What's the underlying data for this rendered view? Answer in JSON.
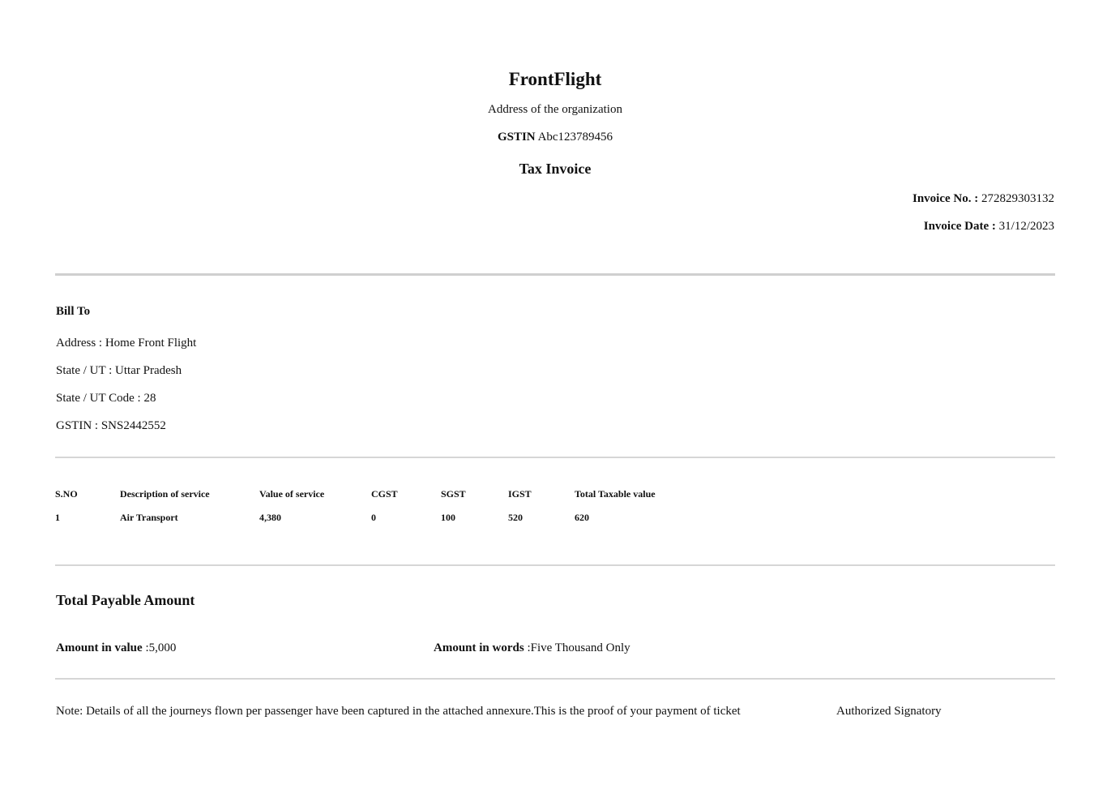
{
  "organization": {
    "name": "FrontFlight",
    "address": "Address of the organization",
    "gstin_label": "GSTIN",
    "gstin_value": "Abc123789456"
  },
  "document": {
    "title": "Tax Invoice"
  },
  "invoice": {
    "number_label": "Invoice No. :",
    "number_value": "272829303132",
    "date_label": "Invoice Date :",
    "date_value": "31/12/2023"
  },
  "bill_to": {
    "heading": "Bill To",
    "address": "Address : Home Front Flight",
    "state": "State / UT : Uttar Pradesh",
    "state_code": "State / UT Code : 28",
    "gstin": "GSTIN : SNS2442552"
  },
  "services_table": {
    "headers": [
      "S.NO",
      "Description of service",
      "Value of service",
      "CGST",
      "SGST",
      "IGST",
      "Total Taxable value"
    ],
    "rows": [
      [
        "1",
        "Air Transport",
        "4,380",
        "0",
        "100",
        "520",
        "620"
      ]
    ]
  },
  "totals": {
    "heading": "Total Payable Amount",
    "value_label": "Amount in value",
    "value_text": " :5,000",
    "words_label": "Amount in words",
    "words_text": " :Five Thousand Only"
  },
  "footer": {
    "note": "Note: Details of all the journeys flown per passenger have been captured in the attached annexure.This is the proof of your payment of ticket",
    "signatory": "Authorized Signatory"
  }
}
